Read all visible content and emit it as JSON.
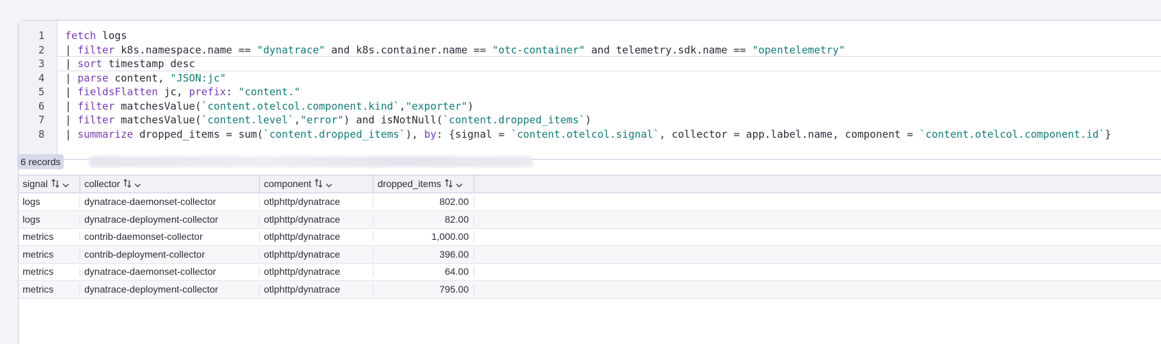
{
  "editor": {
    "line_numbers": [
      "1",
      "2",
      "3",
      "4",
      "5",
      "6",
      "7",
      "8"
    ],
    "lines": [
      [
        {
          "t": "kw",
          "v": "fetch"
        },
        {
          "t": "plain",
          "v": " logs"
        }
      ],
      [
        {
          "t": "pipe",
          "v": "| "
        },
        {
          "t": "kw",
          "v": "filter"
        },
        {
          "t": "plain",
          "v": " k8s.namespace.name == "
        },
        {
          "t": "str",
          "v": "\"dynatrace\""
        },
        {
          "t": "plain",
          "v": " and k8s.container.name == "
        },
        {
          "t": "str",
          "v": "\"otc-container\""
        },
        {
          "t": "plain",
          "v": " and telemetry.sdk.name == "
        },
        {
          "t": "str",
          "v": "\"opentelemetry\""
        }
      ],
      [
        {
          "t": "pipe",
          "v": "| "
        },
        {
          "t": "kw",
          "v": "sort"
        },
        {
          "t": "plain",
          "v": " timestamp desc"
        }
      ],
      [
        {
          "t": "pipe",
          "v": "| "
        },
        {
          "t": "kw",
          "v": "parse"
        },
        {
          "t": "plain",
          "v": " content, "
        },
        {
          "t": "str",
          "v": "\"JSON:jc\""
        }
      ],
      [
        {
          "t": "pipe",
          "v": "| "
        },
        {
          "t": "kw",
          "v": "fieldsFlatten"
        },
        {
          "t": "plain",
          "v": " jc, "
        },
        {
          "t": "kw",
          "v": "prefix"
        },
        {
          "t": "plain",
          "v": ": "
        },
        {
          "t": "str",
          "v": "\"content.\""
        }
      ],
      [
        {
          "t": "pipe",
          "v": "| "
        },
        {
          "t": "kw",
          "v": "filter"
        },
        {
          "t": "plain",
          "v": " matchesValue("
        },
        {
          "t": "str",
          "v": "`content.otelcol.component.kind`"
        },
        {
          "t": "plain",
          "v": ","
        },
        {
          "t": "str",
          "v": "\"exporter\""
        },
        {
          "t": "plain",
          "v": ")"
        }
      ],
      [
        {
          "t": "pipe",
          "v": "| "
        },
        {
          "t": "kw",
          "v": "filter"
        },
        {
          "t": "plain",
          "v": " matchesValue("
        },
        {
          "t": "str",
          "v": "`content.level`"
        },
        {
          "t": "plain",
          "v": ","
        },
        {
          "t": "str",
          "v": "\"error\""
        },
        {
          "t": "plain",
          "v": ") and isNotNull("
        },
        {
          "t": "str",
          "v": "`content.dropped_items`"
        },
        {
          "t": "plain",
          "v": ")"
        }
      ],
      [
        {
          "t": "pipe",
          "v": "| "
        },
        {
          "t": "kw",
          "v": "summarize"
        },
        {
          "t": "plain",
          "v": " dropped_items = sum("
        },
        {
          "t": "str",
          "v": "`content.dropped_items`"
        },
        {
          "t": "plain",
          "v": "), "
        },
        {
          "t": "kw",
          "v": "by"
        },
        {
          "t": "plain",
          "v": ": {signal = "
        },
        {
          "t": "str",
          "v": "`content.otelcol.signal`"
        },
        {
          "t": "plain",
          "v": ", collector = app.label.name, component = "
        },
        {
          "t": "str",
          "v": "`content.otelcol.component.id`"
        },
        {
          "t": "plain",
          "v": "}"
        }
      ]
    ],
    "active_line": 3
  },
  "records": {
    "label": "6 records"
  },
  "table": {
    "columns": [
      "signal",
      "collector",
      "component",
      "dropped_items"
    ],
    "rows": [
      [
        "logs",
        "dynatrace-daemonset-collector",
        "otlphttp/dynatrace",
        "802.00"
      ],
      [
        "logs",
        "dynatrace-deployment-collector",
        "otlphttp/dynatrace",
        "82.00"
      ],
      [
        "metrics",
        "contrib-daemonset-collector",
        "otlphttp/dynatrace",
        "1,000.00"
      ],
      [
        "metrics",
        "contrib-deployment-collector",
        "otlphttp/dynatrace",
        "396.00"
      ],
      [
        "metrics",
        "dynatrace-daemonset-collector",
        "otlphttp/dynatrace",
        "64.00"
      ],
      [
        "metrics",
        "dynatrace-deployment-collector",
        "otlphttp/dynatrace",
        "795.00"
      ]
    ]
  },
  "colors": {
    "keyword": "#7a3bb5",
    "string": "#127a78",
    "border": "#c9cbe0",
    "badge": "#d7d8e8"
  },
  "icons": {
    "sort": "sort-icon",
    "chevron": "chevron-down-icon"
  }
}
